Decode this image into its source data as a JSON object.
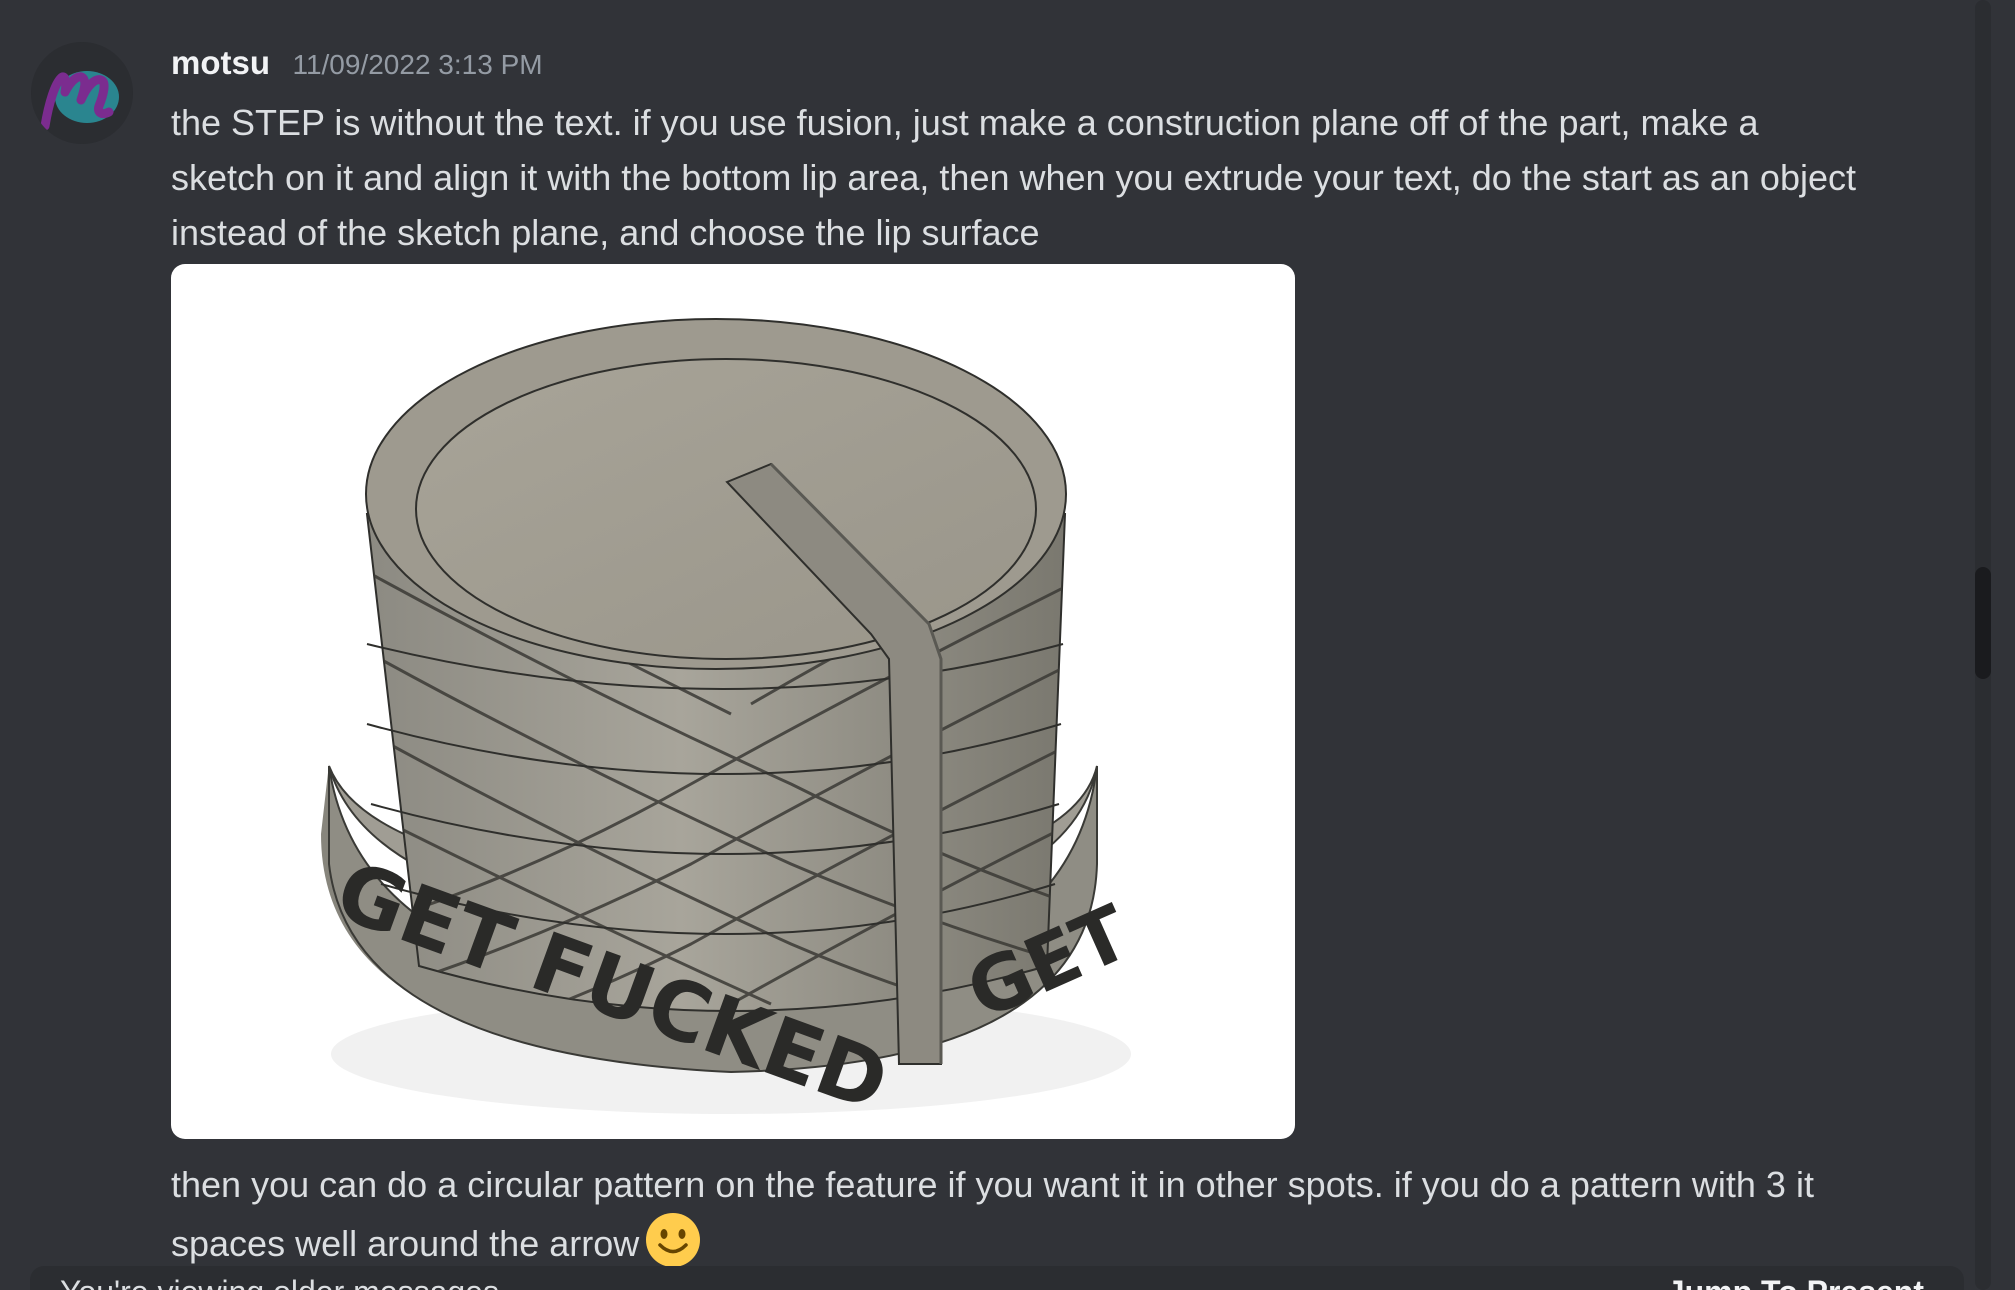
{
  "message": {
    "avatar_icon": "m-letter-logo-icon",
    "username": "motsu",
    "timestamp": "11/09/2022 3:13 PM",
    "text_1": "the STEP is without the text. if you use fusion, just make a construction plane off of the part, make a sketch on it and align it with the bottom lip area, then when you extrude your text, do the start as an object instead of the sketch plane, and choose the lip surface",
    "attachment": {
      "kind": "3d-render-image",
      "engraved_text": "GET FUCKED",
      "engraved_text_partial": "GET",
      "engraved_text_edge": "GET F"
    },
    "text_2": "then you can do a circular pattern on the feature if you want it in other spots. if you do a pattern with 3 it spaces well around the arrow",
    "emoji": "slightly-smiling-face-icon"
  },
  "bottom_bar": {
    "left_text": "You're viewing older messages",
    "right_text": "Jump To Present"
  },
  "colors": {
    "background": "#313338",
    "text": "#dbdee1",
    "username": "#f2f3f5",
    "timestamp": "#949ba4",
    "avatar_purple": "#7b2c8f",
    "avatar_teal": "#2a8f9a"
  }
}
